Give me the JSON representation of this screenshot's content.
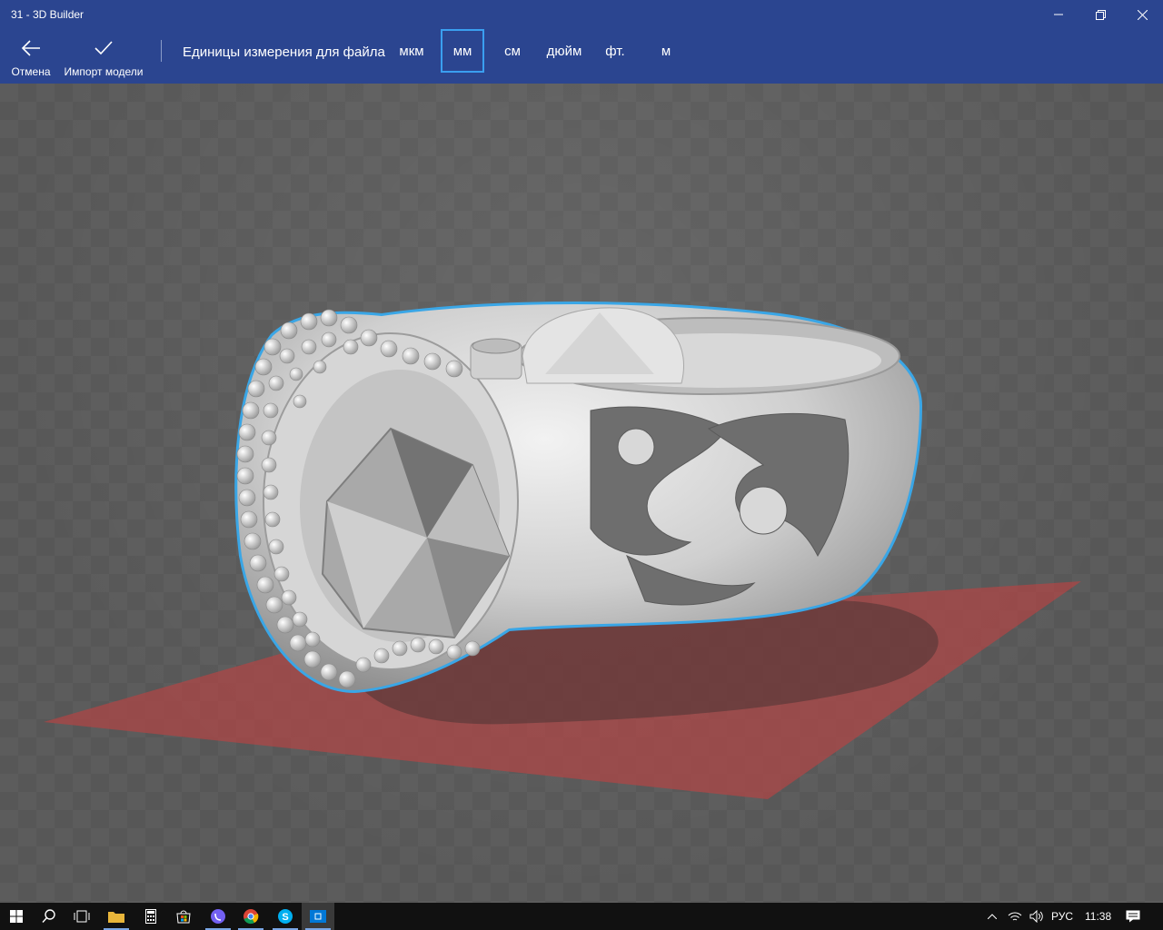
{
  "window": {
    "title": "31 - 3D Builder"
  },
  "toolbar": {
    "cancel_label": "Отмена",
    "import_label": "Импорт модели",
    "units_label": "Единицы измерения для файла",
    "units": [
      "мкм",
      "мм",
      "см",
      "дюйм",
      "фт.",
      "м"
    ],
    "selected_unit": "мм"
  },
  "taskbar": {
    "language": "РУС",
    "time": "11:38"
  },
  "colors": {
    "chrome": "#2b4590",
    "selection_outline": "#3aa6e6",
    "floor_plate": "#b04545"
  }
}
